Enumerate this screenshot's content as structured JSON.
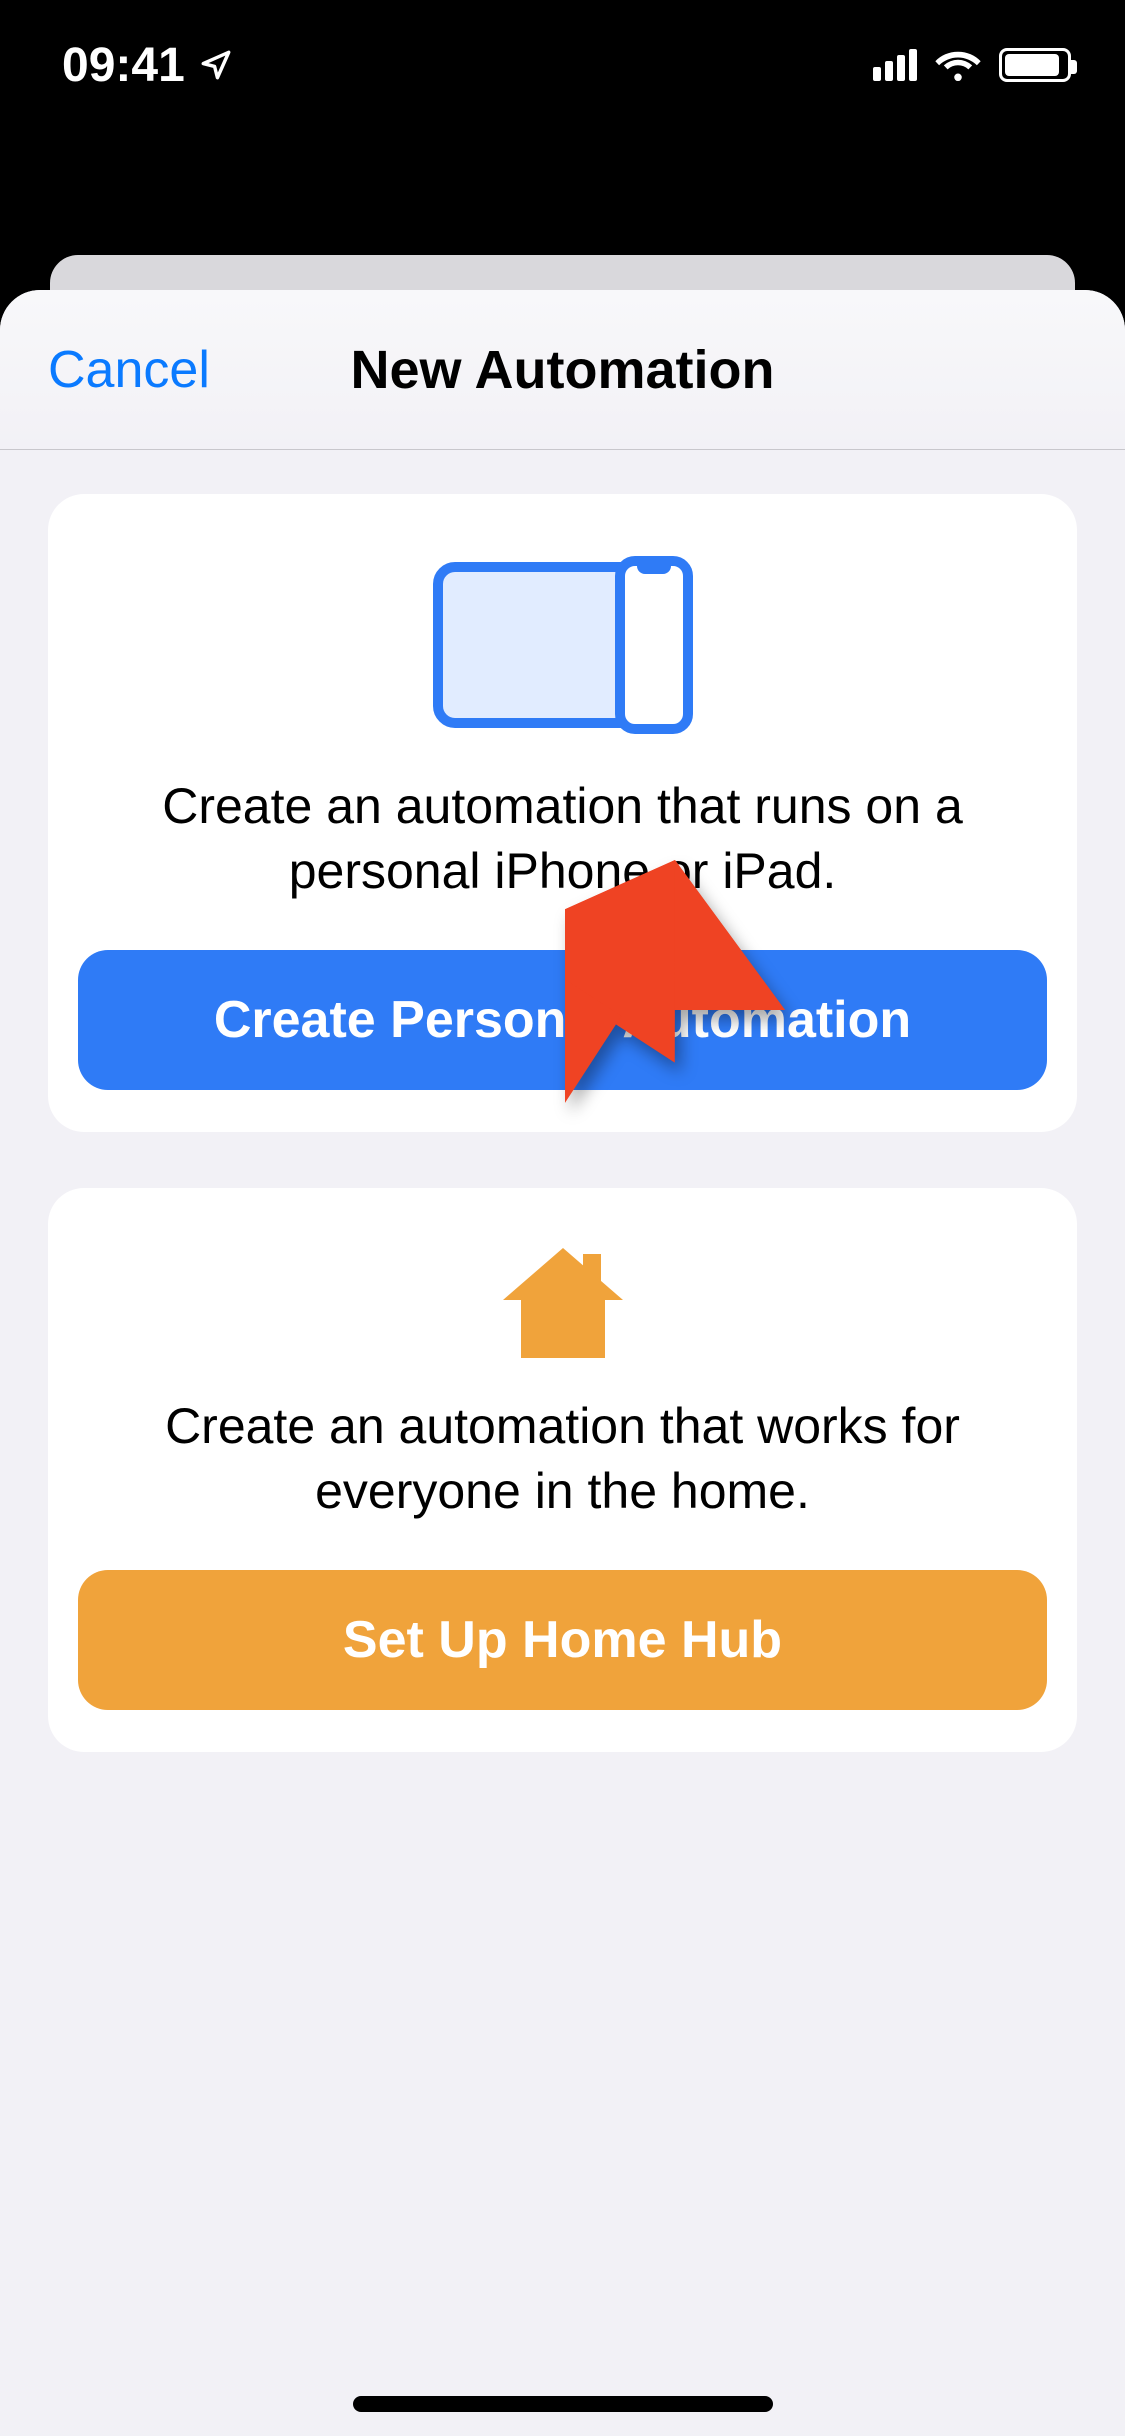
{
  "status": {
    "time": "09:41",
    "location_icon": "location-arrow",
    "signal": "cellular-signal",
    "wifi": "wifi",
    "battery": "battery-full"
  },
  "nav": {
    "cancel_label": "Cancel",
    "title": "New Automation"
  },
  "personal_card": {
    "icon": "devices-icon",
    "description": "Create an automation that runs on a personal iPhone or iPad.",
    "button_label": "Create Personal Automation"
  },
  "home_card": {
    "icon": "home-icon",
    "description": "Create an automation that works for everyone in the home.",
    "button_label": "Set Up Home Hub"
  },
  "annotation": {
    "arrow_color": "#ef4323",
    "points_to": "create-personal-automation-button"
  }
}
